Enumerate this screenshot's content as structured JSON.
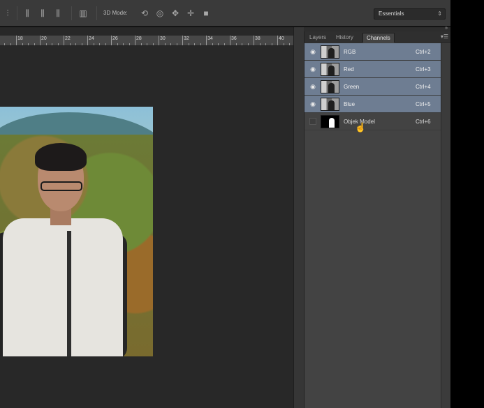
{
  "options_bar": {
    "mode_label": "3D Mode:",
    "workspace": "Essentials"
  },
  "ruler": {
    "ticks": [
      "18",
      "20",
      "22",
      "24",
      "26",
      "28",
      "30",
      "32",
      "34",
      "36",
      "38",
      "40"
    ]
  },
  "panel": {
    "tabs": [
      {
        "label": "Layers",
        "active": false
      },
      {
        "label": "History",
        "active": false
      },
      {
        "label": "Channels",
        "active": true
      }
    ],
    "channels": [
      {
        "name": "RGB",
        "shortcut": "Ctrl+2",
        "visible": true,
        "selected": true
      },
      {
        "name": "Red",
        "shortcut": "Ctrl+3",
        "visible": true,
        "selected": true
      },
      {
        "name": "Green",
        "shortcut": "Ctrl+4",
        "visible": true,
        "selected": true
      },
      {
        "name": "Blue",
        "shortcut": "Ctrl+5",
        "visible": true,
        "selected": true
      },
      {
        "name": "Objek Model",
        "shortcut": "Ctrl+6",
        "visible": false,
        "selected": false
      }
    ]
  },
  "colors": {
    "selection": "#6e7d92",
    "panel_bg": "#434343",
    "canvas_bg": "#282828"
  }
}
